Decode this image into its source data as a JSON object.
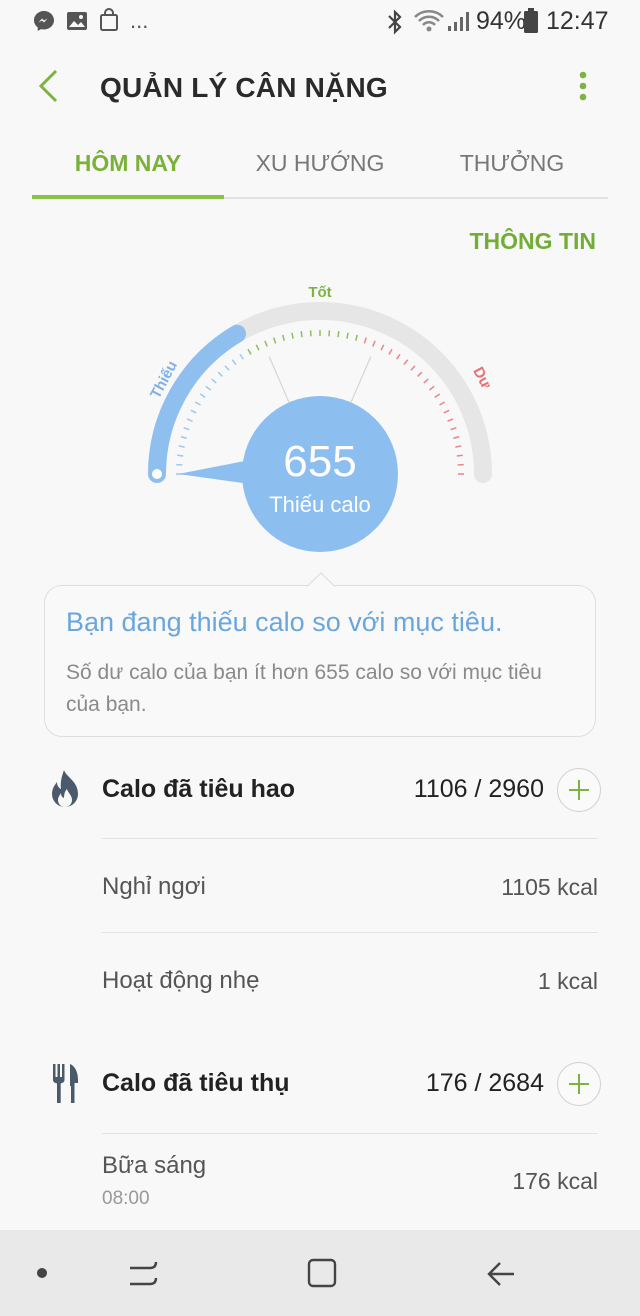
{
  "status_bar": {
    "battery": "94%",
    "time": "12:47",
    "more_notifications": "...",
    "icons": [
      "messenger-icon",
      "gallery-icon",
      "shopping-bag-icon",
      "bluetooth-icon",
      "wifi-icon",
      "signal-icon",
      "battery-icon"
    ]
  },
  "app_bar": {
    "title": "QUẢN LÝ CÂN NẶNG",
    "back_icon": "back-arrow-icon",
    "menu_icon": "more-vert-icon"
  },
  "tabs": [
    {
      "label": "HÔM NAY",
      "active": true
    },
    {
      "label": "XU HƯỚNG",
      "active": false
    },
    {
      "label": "THƯỞNG",
      "active": false
    }
  ],
  "info_link": "THÔNG TIN",
  "gauge": {
    "label_low": "Thiếu",
    "label_good": "Tốt",
    "label_high": "Dư",
    "value": "655",
    "value_label": "Thiếu calo",
    "fill_fraction": 0.33,
    "colors": {
      "low": "#8fbfef",
      "good": "#7cb342",
      "high": "#e57373",
      "track": "#e6e6e6"
    }
  },
  "message": {
    "heading": "Bạn đang thiếu calo so với mục tiêu.",
    "body": "Số dư calo của bạn ít hơn 655 calo so với mục tiêu của bạn."
  },
  "burned": {
    "icon": "flame-icon",
    "label": "Calo đã tiêu hao",
    "value": "1106 / 2960",
    "items": [
      {
        "label": "Nghỉ ngơi",
        "value": "1105 kcal"
      },
      {
        "label": "Hoạt động nhẹ",
        "value": "1 kcal"
      }
    ]
  },
  "consumed": {
    "icon": "fork-knife-icon",
    "label": "Calo đã tiêu thụ",
    "value": "176 / 2684",
    "items": [
      {
        "label": "Bữa sáng",
        "time": "08:00",
        "value": "176 kcal"
      }
    ]
  },
  "nav_bar": {
    "icons": [
      "dot-icon",
      "recents-icon",
      "home-icon",
      "back-icon"
    ]
  },
  "accent_color": "#7cb342"
}
